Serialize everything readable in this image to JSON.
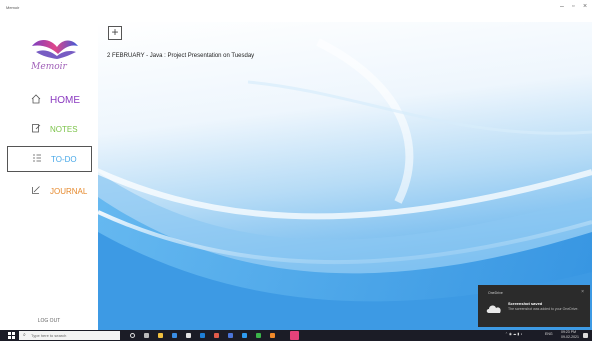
{
  "window": {
    "title": "Memoir",
    "minimize": "–",
    "maximize": "▫",
    "close": "×"
  },
  "sidebar": {
    "logo_text": "Memoir",
    "items": [
      {
        "label": "HOME",
        "icon": "home-icon",
        "color": "#8b3ac0"
      },
      {
        "label": "NOTES",
        "icon": "notes-icon",
        "color": "#7cc34a"
      },
      {
        "label": "TO-DO",
        "icon": "checklist-icon",
        "color": "#48a8e8"
      },
      {
        "label": "JOURNAL",
        "icon": "journal-icon",
        "color": "#e68a2e"
      }
    ],
    "logout_label": "LOG OUT"
  },
  "main": {
    "add_button_label": "+",
    "notes": [
      "2 FEBRUARY - Java : Project Presentation on Tuesday"
    ]
  },
  "notification": {
    "app": "OneDrive",
    "close": "×",
    "title": "Screenshot saved",
    "body": "The screenshot was added to your OneDrive."
  },
  "taskbar": {
    "search_placeholder": "Type here to search",
    "tray_lang": "ENG",
    "tray_time": "09:23 PM",
    "tray_date": "09-02-2021"
  }
}
